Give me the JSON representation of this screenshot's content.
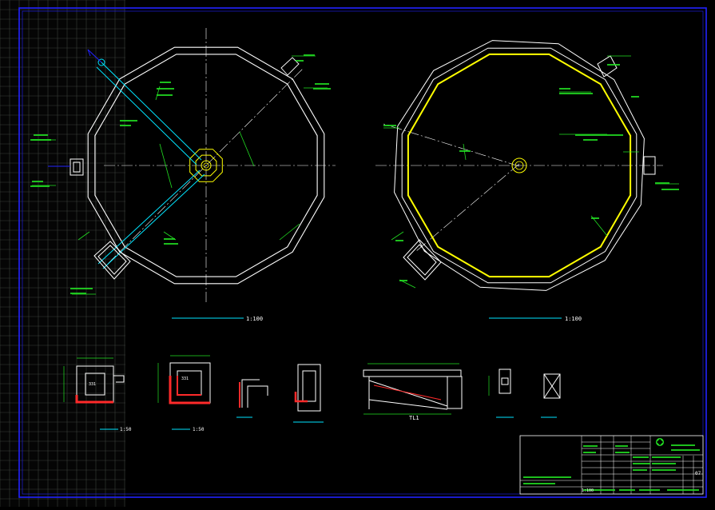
{
  "colors": {
    "background": "#000000",
    "frame": "#2222ff",
    "outline": "#ffffff",
    "dim": "#22e022",
    "pipe": "#00e5ff",
    "yellow": "#ffff00",
    "red": "#ff2a2a",
    "grid": "#3a3f3a"
  },
  "plans": {
    "left_scale": "1:100",
    "right_scale": "1:100"
  },
  "sections": {
    "scale_a": "1:50",
    "scale_b": "1:50",
    "label_tl1": "TL1",
    "room_a": "331",
    "room_b": "331"
  },
  "title_block": {
    "sheet_no": "07",
    "scale_value": "1:100"
  }
}
